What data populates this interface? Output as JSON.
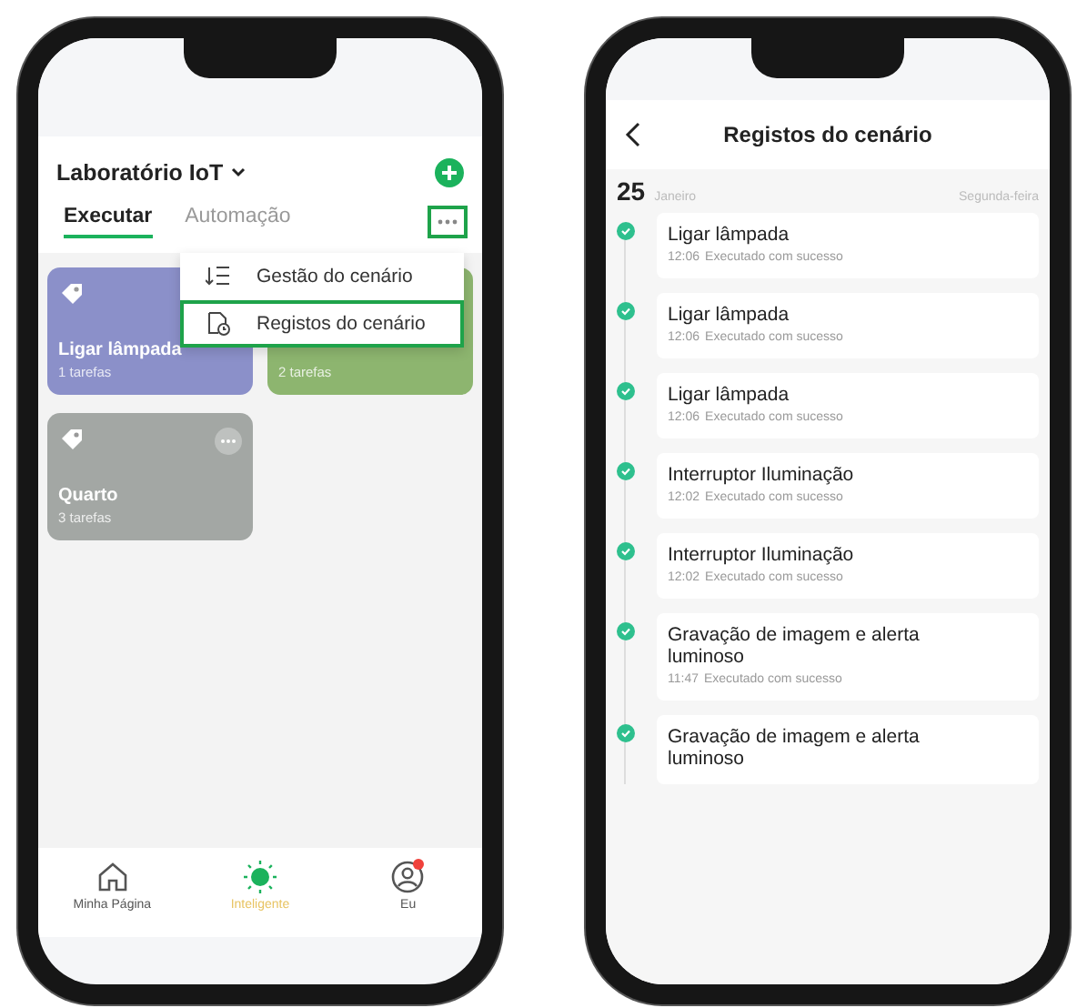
{
  "scenes_screen": {
    "home": {
      "title": "Laboratório IoT",
      "more_highlighted": true
    },
    "tabs": [
      {
        "label": "Executar",
        "selected": true
      },
      {
        "label": "Automação",
        "selected": false
      }
    ],
    "cards": [
      {
        "title": "Ligar lâmpada",
        "subtitle": "1 tarefas",
        "color": "#8b90c9"
      },
      {
        "subtitle": "2 tarefas",
        "color": "#8db56f"
      },
      {
        "title": "Quarto",
        "subtitle": "3 tarefas",
        "color": "#a3a7a4",
        "more": true
      }
    ],
    "menu": [
      {
        "label": "Gestão do cenário",
        "selected": false
      },
      {
        "label": "Registos do cenário",
        "selected": true
      }
    ],
    "nav": [
      {
        "label": "Minha Página",
        "selected": false,
        "badge": false
      },
      {
        "label": "Inteligente",
        "selected": true,
        "badge": false
      },
      {
        "label": "Eu",
        "selected": false,
        "badge": true
      }
    ]
  },
  "log_screen": {
    "title": "Registos do cenário",
    "date": {
      "day": "25",
      "month": "Janeiro",
      "weekday": "Segunda-feira"
    },
    "records": [
      {
        "title": "Ligar lâmpada",
        "time": "12:06",
        "status": "Executado com sucesso"
      },
      {
        "title": "Ligar lâmpada",
        "time": "12:06",
        "status": "Executado com sucesso"
      },
      {
        "title": "Ligar lâmpada",
        "time": "12:06",
        "status": "Executado com sucesso"
      },
      {
        "title": "Interruptor Iluminação",
        "time": "12:02",
        "status": "Executado com sucesso"
      },
      {
        "title": "Interruptor Iluminação",
        "time": "12:02",
        "status": "Executado com sucesso"
      },
      {
        "title": "Gravação de imagem e alerta luminoso",
        "time": "11:47",
        "status": "Executado com sucesso"
      },
      {
        "title": "Gravação de imagem e alerta luminoso"
      }
    ]
  }
}
